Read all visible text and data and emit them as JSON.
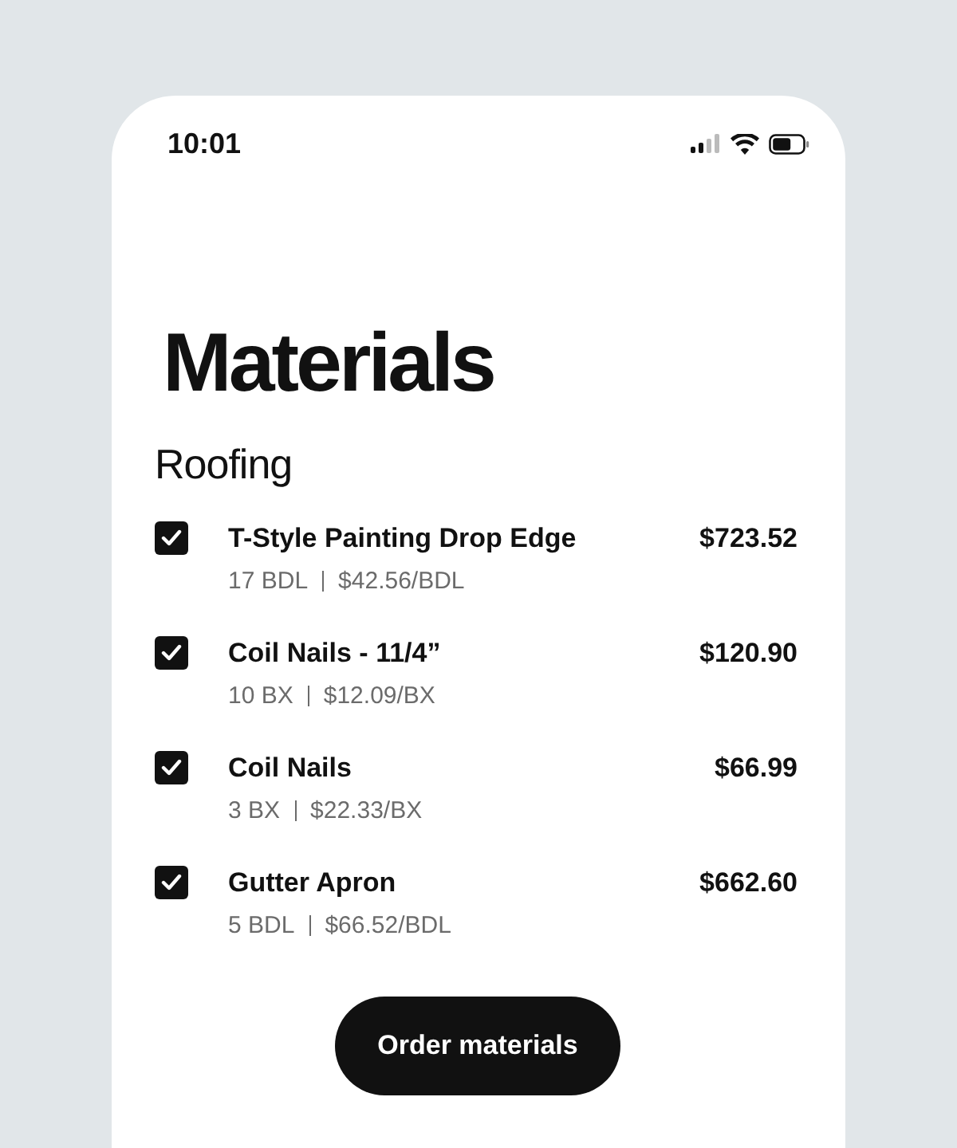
{
  "status_bar": {
    "time": "10:01"
  },
  "title": "Materials",
  "section": "Roofing",
  "items": [
    {
      "name": "T-Style Painting Drop Edge",
      "quantity": "17 BDL",
      "unit_price": "$42.56/BDL",
      "total": "$723.52",
      "checked": true
    },
    {
      "name": "Coil Nails - 11/4”",
      "quantity": "10 BX",
      "unit_price": "$12.09/BX",
      "total": "$120.90",
      "checked": true
    },
    {
      "name": "Coil Nails",
      "quantity": "3 BX",
      "unit_price": "$22.33/BX",
      "total": "$66.99",
      "checked": true
    },
    {
      "name": "Gutter Apron",
      "quantity": "5 BDL",
      "unit_price": "$66.52/BDL",
      "total": "$662.60",
      "checked": true
    }
  ],
  "button": "Order materials"
}
